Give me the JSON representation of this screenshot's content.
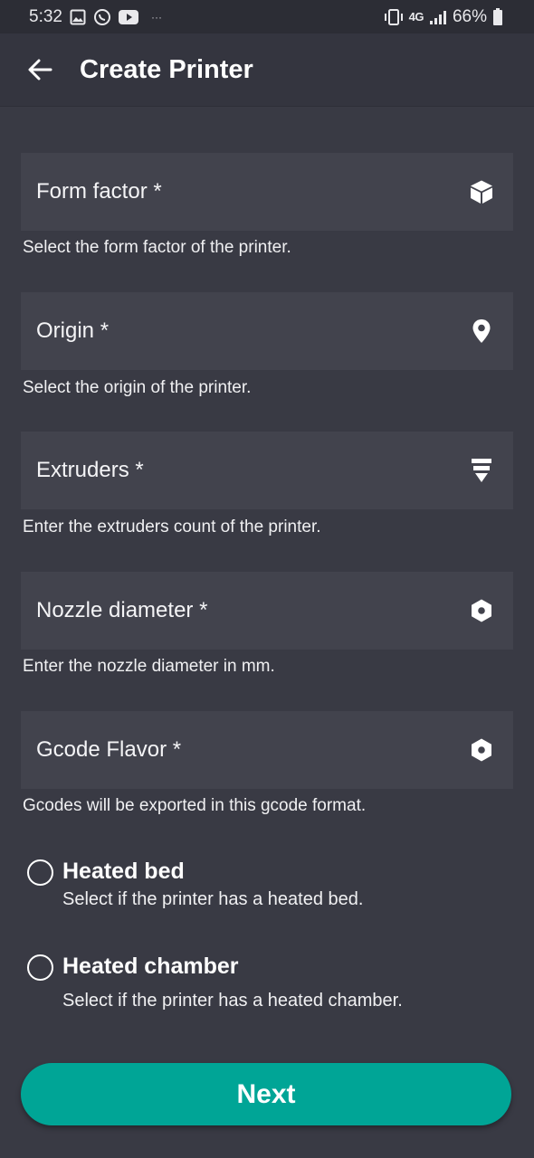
{
  "status_bar": {
    "time": "5:32",
    "dots": "···",
    "network": "4G",
    "battery": "66%"
  },
  "app_bar": {
    "title": "Create Printer"
  },
  "fields": [
    {
      "label": "Form factor *",
      "helper": "Select the form factor of the printer.",
      "icon": "cube-icon"
    },
    {
      "label": "Origin *",
      "helper": "Select the origin of the printer.",
      "icon": "location-pin-icon"
    },
    {
      "label": "Extruders *",
      "helper": "Enter the extruders count of the printer.",
      "icon": "extruder-icon"
    },
    {
      "label": "Nozzle diameter *",
      "helper": "Enter the nozzle diameter in mm.",
      "icon": "nozzle-icon"
    },
    {
      "label": "Gcode Flavor *",
      "helper": "Gcodes will be exported in this gcode format.",
      "icon": "nozzle-icon"
    }
  ],
  "checkboxes": [
    {
      "title": "Heated bed",
      "description": "Select if the printer has a heated bed.",
      "checked": false
    },
    {
      "title": "Heated chamber",
      "description": "Select if the printer has a heated chamber.",
      "checked": false
    }
  ],
  "next_button": {
    "label": "Next"
  },
  "colors": {
    "background": "#393a44",
    "field": "#42434d",
    "accent": "#00a596"
  }
}
